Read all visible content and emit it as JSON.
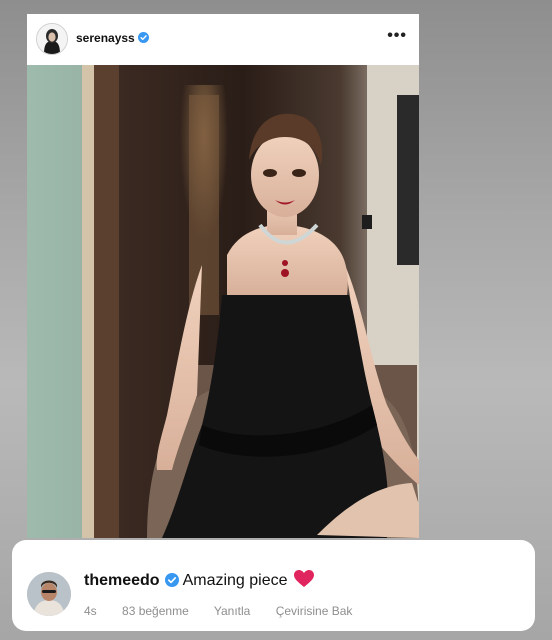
{
  "post": {
    "username": "serenayss",
    "verified": true,
    "more_icon": "more-horizontal-icon",
    "more_label": "•••",
    "photo_description_colors": {
      "dress": "#111111",
      "background": "#3a2a20"
    }
  },
  "reply": {
    "username": "themeedo",
    "verified": true,
    "text": "Amazing piece",
    "emoji_icon": "red-heart-icon",
    "time": "4s",
    "likes": "83 beğenme",
    "reply_label": "Yanıtla",
    "translate_label": "Çevirisine Bak"
  },
  "colors": {
    "verified_blue": "#3897f0",
    "heart_red": "#e0245e",
    "meta_gray": "#8e8e8e"
  }
}
